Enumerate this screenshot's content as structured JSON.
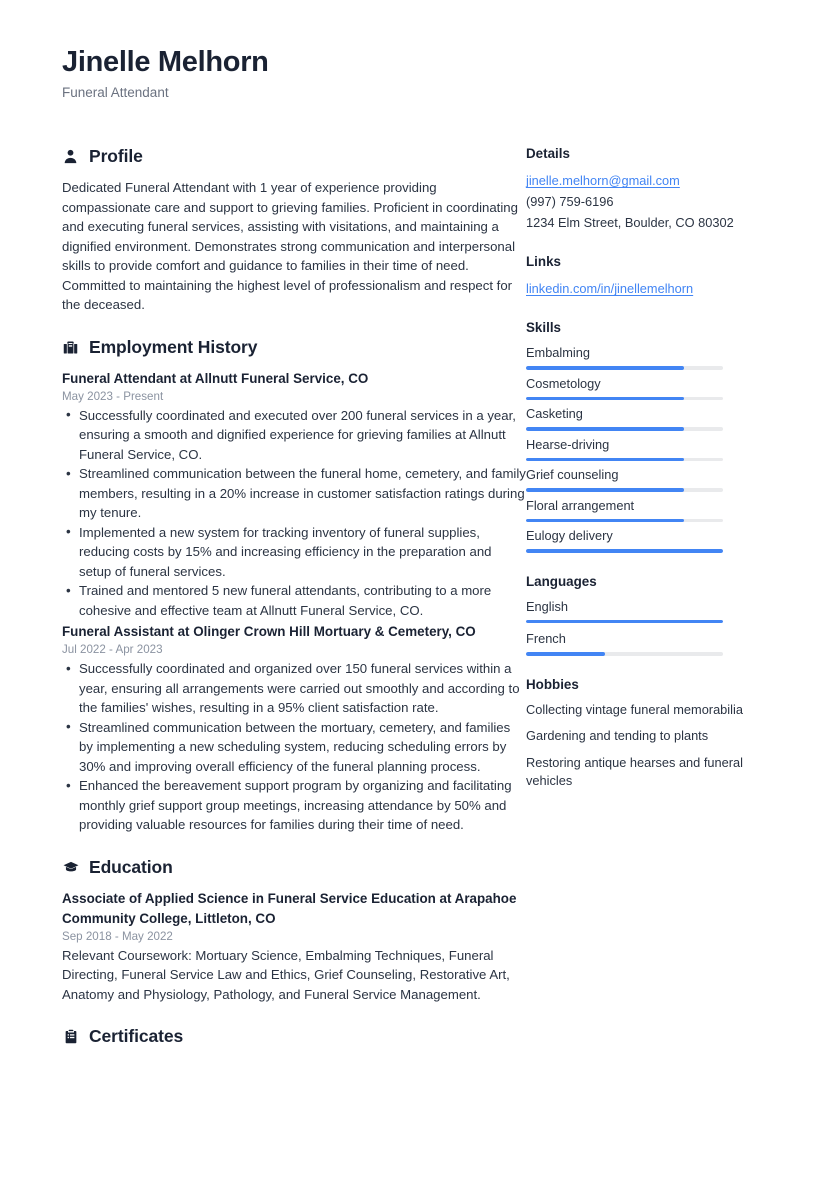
{
  "header": {
    "full_name": "Jinelle Melhorn",
    "job_title": "Funeral Attendant"
  },
  "main": {
    "profile": {
      "heading": "Profile",
      "icon": "user-icon",
      "text": "Dedicated Funeral Attendant with 1 year of experience providing compassionate care and support to grieving families. Proficient in coordinating and executing funeral services, assisting with visitations, and maintaining a dignified environment. Demonstrates strong communication and interpersonal skills to provide comfort and guidance to families in their time of need. Committed to maintaining the highest level of professionalism and respect for the deceased."
    },
    "employment": {
      "heading": "Employment History",
      "icon": "briefcase-icon",
      "entries": [
        {
          "title": "Funeral Attendant at Allnutt Funeral Service, CO",
          "date": "May 2023 - Present",
          "bullets": [
            "Successfully coordinated and executed over 200 funeral services in a year, ensuring a smooth and dignified experience for grieving families at Allnutt Funeral Service, CO.",
            "Streamlined communication between the funeral home, cemetery, and family members, resulting in a 20% increase in customer satisfaction ratings during my tenure.",
            "Implemented a new system for tracking inventory of funeral supplies, reducing costs by 15% and increasing efficiency in the preparation and setup of funeral services.",
            "Trained and mentored 5 new funeral attendants, contributing to a more cohesive and effective team at Allnutt Funeral Service, CO."
          ]
        },
        {
          "title": "Funeral Assistant at Olinger Crown Hill Mortuary & Cemetery, CO",
          "date": "Jul 2022 - Apr 2023",
          "bullets": [
            "Successfully coordinated and organized over 150 funeral services within a year, ensuring all arrangements were carried out smoothly and according to the families' wishes, resulting in a 95% client satisfaction rate.",
            "Streamlined communication between the mortuary, cemetery, and families by implementing a new scheduling system, reducing scheduling errors by 30% and improving overall efficiency of the funeral planning process.",
            "Enhanced the bereavement support program by organizing and facilitating monthly grief support group meetings, increasing attendance by 50% and providing valuable resources for families during their time of need."
          ]
        }
      ]
    },
    "education": {
      "heading": "Education",
      "icon": "graduation-cap-icon",
      "entries": [
        {
          "title": "Associate of Applied Science in Funeral Service Education at Arapahoe Community College, Littleton, CO",
          "date": "Sep 2018 - May 2022",
          "description": "Relevant Coursework: Mortuary Science, Embalming Techniques, Funeral Directing, Funeral Service Law and Ethics, Grief Counseling, Restorative Art, Anatomy and Physiology, Pathology, and Funeral Service Management."
        }
      ]
    },
    "certificates": {
      "heading": "Certificates",
      "icon": "clipboard-icon"
    }
  },
  "sidebar": {
    "details": {
      "heading": "Details",
      "email": "jinelle.melhorn@gmail.com",
      "phone": "(997) 759-6196",
      "address": "1234 Elm Street, Boulder, CO 80302"
    },
    "links": {
      "heading": "Links",
      "items": [
        {
          "label": "linkedin.com/in/jinellemelhorn"
        }
      ]
    },
    "skills": {
      "heading": "Skills",
      "items": [
        {
          "label": "Embalming",
          "level": 80
        },
        {
          "label": "Cosmetology",
          "level": 80
        },
        {
          "label": "Casketing",
          "level": 80
        },
        {
          "label": "Hearse-driving",
          "level": 80
        },
        {
          "label": "Grief counseling",
          "level": 80
        },
        {
          "label": "Floral arrangement",
          "level": 80
        },
        {
          "label": "Eulogy delivery",
          "level": 100
        }
      ]
    },
    "languages": {
      "heading": "Languages",
      "items": [
        {
          "label": "English",
          "level": 100
        },
        {
          "label": "French",
          "level": 40
        }
      ]
    },
    "hobbies": {
      "heading": "Hobbies",
      "items": [
        {
          "label": "Collecting vintage funeral memorabilia"
        },
        {
          "label": "Gardening and tending to plants"
        },
        {
          "label": "Restoring antique hearses and funeral vehicles"
        }
      ]
    }
  },
  "colors": {
    "accent": "#4285f4",
    "heading": "#1a2233",
    "body_text": "#2b3443",
    "muted": "#8b93a1",
    "track": "#e9eaec"
  }
}
